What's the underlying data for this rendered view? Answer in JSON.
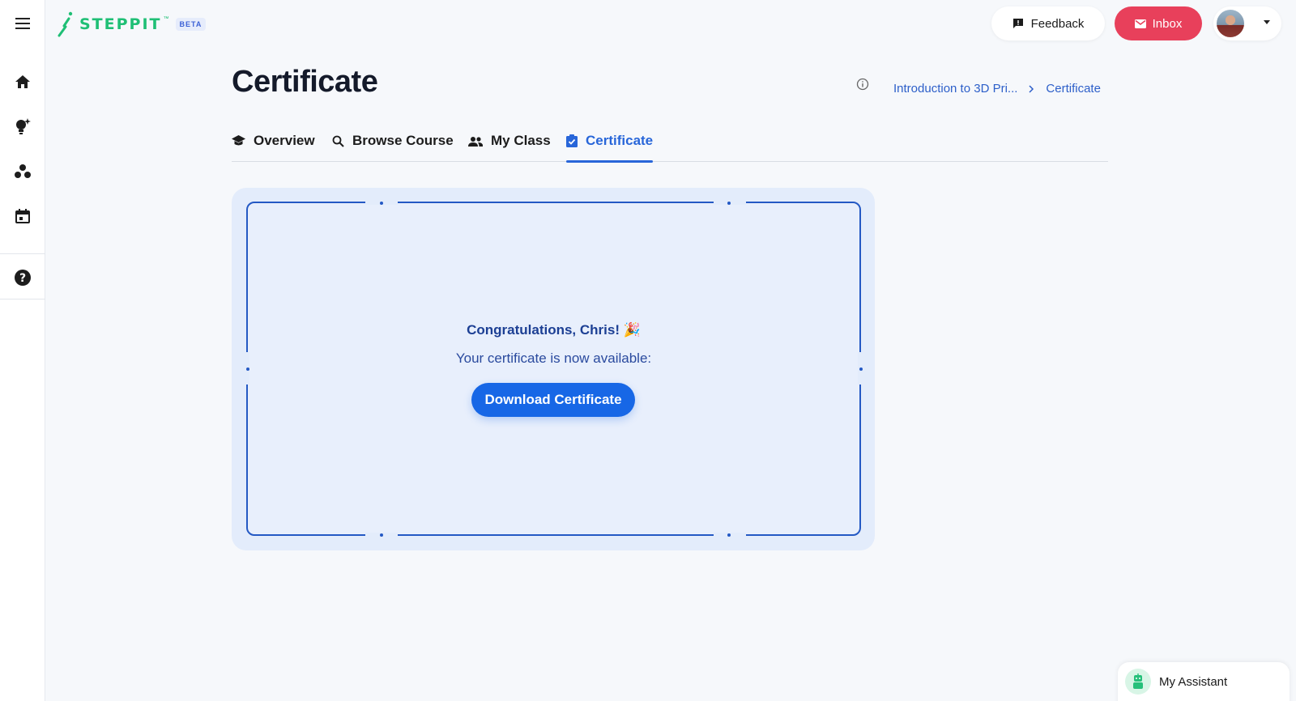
{
  "app": {
    "brand": "STEPPIT",
    "brand_tm": "™",
    "beta_label": "BETA"
  },
  "sidebar": {
    "items": [
      {
        "name": "menu-icon"
      },
      {
        "name": "home-icon"
      },
      {
        "name": "lightbulb-icon"
      },
      {
        "name": "community-icon"
      },
      {
        "name": "calendar-icon"
      },
      {
        "name": "help-icon"
      }
    ]
  },
  "header": {
    "feedback_label": "Feedback",
    "inbox_label": "Inbox"
  },
  "page": {
    "title": "Certificate"
  },
  "breadcrumb": {
    "course": "Introduction to 3D Pri...",
    "current": "Certificate"
  },
  "tabs": [
    {
      "label": "Overview",
      "icon": "graduation-cap-icon"
    },
    {
      "label": "Browse Course",
      "icon": "search-icon"
    },
    {
      "label": "My Class",
      "icon": "people-icon"
    },
    {
      "label": "Certificate",
      "icon": "certificate-check-icon",
      "active": true
    }
  ],
  "certificate": {
    "congrats": "Congratulations, Chris! 🎉",
    "message": "Your certificate is now available:",
    "download_label": "Download Certificate"
  },
  "assistant": {
    "label": "My Assistant"
  },
  "colors": {
    "accent": "#2866d9",
    "brand_green": "#1fbf75",
    "inbox_red": "#e8405b",
    "frame_blue": "#2459c4"
  }
}
